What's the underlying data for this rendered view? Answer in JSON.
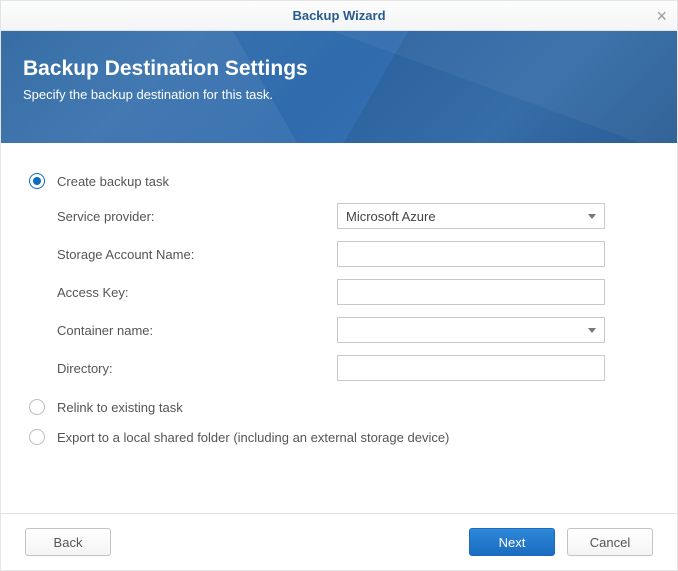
{
  "window": {
    "title": "Backup Wizard"
  },
  "banner": {
    "title": "Backup Destination Settings",
    "subtitle": "Specify the backup destination for this task."
  },
  "options": {
    "create": {
      "label": "Create backup task",
      "selected": true
    },
    "relink": {
      "label": "Relink to existing task",
      "selected": false
    },
    "export": {
      "label": "Export to a local shared folder (including an external storage device)",
      "selected": false
    }
  },
  "form": {
    "service_provider": {
      "label": "Service provider:",
      "value": "Microsoft Azure"
    },
    "storage_account": {
      "label": "Storage Account Name:",
      "value": ""
    },
    "access_key": {
      "label": "Access Key:",
      "value": ""
    },
    "container_name": {
      "label": "Container name:",
      "value": ""
    },
    "directory": {
      "label": "Directory:",
      "value": ""
    }
  },
  "buttons": {
    "back": "Back",
    "next": "Next",
    "cancel": "Cancel"
  }
}
